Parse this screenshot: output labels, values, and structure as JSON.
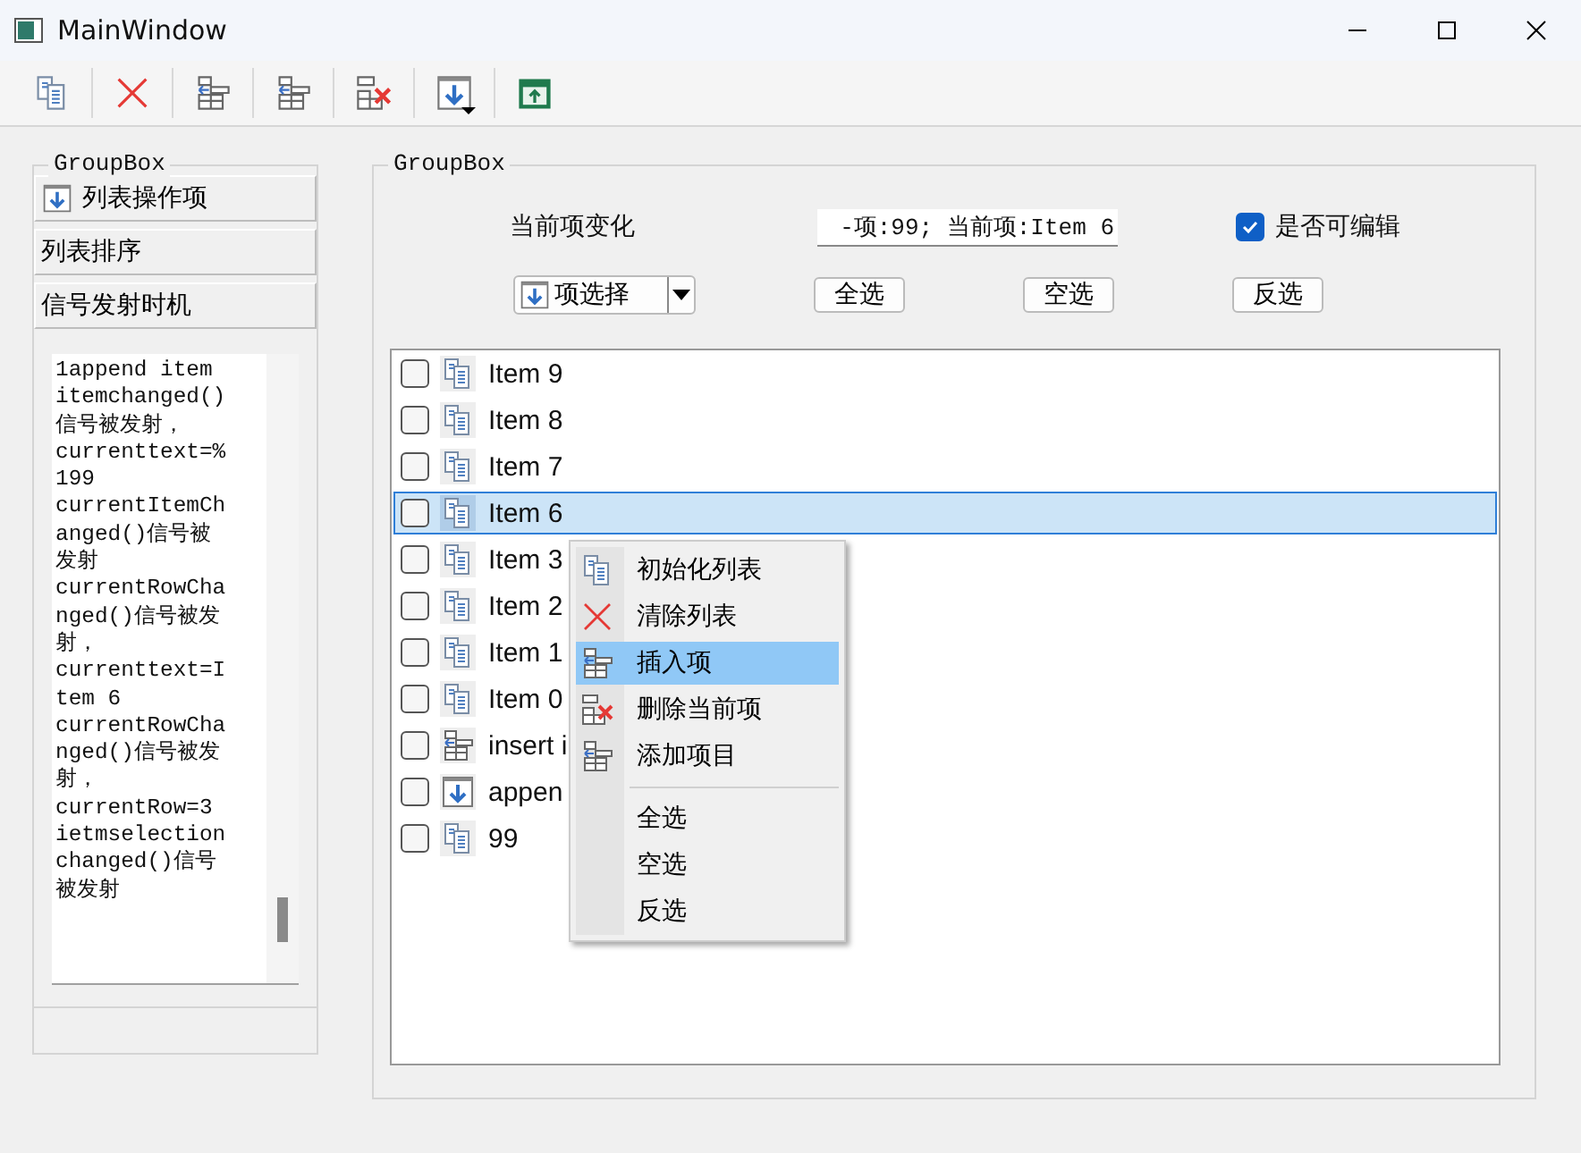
{
  "window": {
    "title": "MainWindow"
  },
  "toolbar": [
    {
      "kind": "copy"
    },
    {
      "kind": "clear"
    },
    {
      "kind": "insert"
    },
    {
      "kind": "insert"
    },
    {
      "kind": "remove"
    },
    {
      "kind": "append"
    },
    {
      "kind": "window"
    }
  ],
  "left_group": {
    "title": "GroupBox",
    "pages": [
      {
        "label": "列表操作项",
        "kind": "append"
      },
      {
        "label": "列表排序",
        "kind": "plain"
      },
      {
        "label": "信号发射时机",
        "kind": "plain"
      }
    ],
    "log_lines": [
      "1append item",
      "itemchanged()",
      "信号被发射，",
      "currenttext=%",
      "199",
      "currentItemCh",
      "anged()信号被",
      "发射",
      "currentRowCha",
      "nged()信号被发",
      "射，",
      "currenttext=I",
      "tem 6",
      "currentRowCha",
      "nged()信号被发",
      "射，",
      "currentRow=3",
      "ietmselection",
      "changed()信号",
      "被发射"
    ]
  },
  "right_group": {
    "title": "GroupBox",
    "change_label": "当前项变化",
    "current_field": {
      "value": "-项:99; 当前项:Item 6"
    },
    "editable": {
      "label": "是否可编辑",
      "checked": true
    },
    "item_select": {
      "label": "项选择"
    },
    "buttons": [
      "全选",
      "空选",
      "反选"
    ],
    "list": [
      {
        "text": "Item 9",
        "kind": "copy",
        "checked": false,
        "selected": false
      },
      {
        "text": "Item 8",
        "kind": "copy",
        "checked": false,
        "selected": false
      },
      {
        "text": "Item 7",
        "kind": "copy",
        "checked": false,
        "selected": false
      },
      {
        "text": "Item 6",
        "kind": "copy",
        "checked": false,
        "selected": true
      },
      {
        "text": "Item 3",
        "kind": "copy",
        "checked": false,
        "selected": false
      },
      {
        "text": "Item 2",
        "kind": "copy",
        "checked": false,
        "selected": false
      },
      {
        "text": "Item 1",
        "kind": "copy",
        "checked": false,
        "selected": false
      },
      {
        "text": "Item 0",
        "kind": "copy",
        "checked": false,
        "selected": false
      },
      {
        "text": "insert i",
        "kind": "insert",
        "checked": false,
        "selected": false
      },
      {
        "text": "appen",
        "kind": "append",
        "checked": false,
        "selected": false
      },
      {
        "text": "99",
        "kind": "copy",
        "checked": false,
        "selected": false
      }
    ]
  },
  "context_menu": [
    {
      "label": "初始化列表",
      "kind": "copy",
      "selected": false
    },
    {
      "label": "清除列表",
      "kind": "clear",
      "selected": false
    },
    {
      "label": "插入项",
      "kind": "insert",
      "selected": true
    },
    {
      "label": "删除当前项",
      "kind": "remove",
      "selected": false
    },
    {
      "label": "添加项目",
      "kind": "insert",
      "selected": false
    },
    {
      "kind": "separator"
    },
    {
      "label": "全选",
      "kind": "plain",
      "selected": false
    },
    {
      "label": "空选",
      "kind": "plain",
      "selected": false
    },
    {
      "label": "反选",
      "kind": "plain",
      "selected": false
    }
  ]
}
